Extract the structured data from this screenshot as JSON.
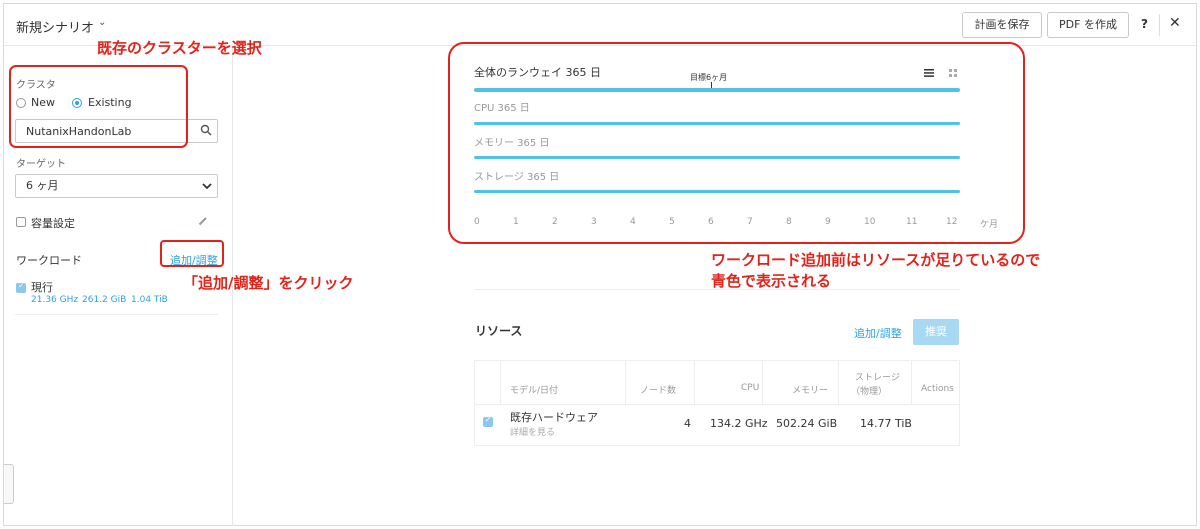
{
  "header": {
    "title": "新規シナリオ",
    "save_label": "計画を保存",
    "pdf_label": "PDF を作成",
    "help_label": "?",
    "close_label": "✕"
  },
  "sidebar": {
    "cluster_label": "クラスタ",
    "radio_new": "New",
    "radio_existing": "Existing",
    "cluster_selected": "Existing",
    "cluster_value": "NutanixHandonLab",
    "target_label": "ターゲット",
    "target_value": "6 ヶ月",
    "capacity_label": "容量設定",
    "workload_label": "ワークロード",
    "workload_add": "追加/調整",
    "current_label": "現行",
    "current_checked": true,
    "stat_cpu": "21.36 GHz",
    "stat_mem": "261.2 GiB",
    "stat_storage": "1.04 TiB"
  },
  "runway": {
    "title": "全体のランウェイ 365 日",
    "target_label": "目標6ヶ月",
    "target_month": 6,
    "cpu_label": "CPU 365 日",
    "memory_label": "メモリー 365 日",
    "storage_label": "ストレージ 365 日",
    "bar_color": "#4fc3e4",
    "months": [
      "0",
      "1",
      "2",
      "3",
      "4",
      "5",
      "6",
      "7",
      "8",
      "9",
      "10",
      "11",
      "12"
    ],
    "unit": "ケ月"
  },
  "resources": {
    "title": "リソース",
    "add_label": "追加/調整",
    "recommend_label": "推奨",
    "headers": {
      "model": "モデル/日付",
      "nodes": "ノード数",
      "cpu": "CPU",
      "memory": "メモリー",
      "storage_1": "ストレージ",
      "storage_2": "（物理）",
      "actions": "Actions"
    },
    "row": {
      "checked": true,
      "model": "既存ハードウェア",
      "details_link": "詳細を見る",
      "nodes": "4",
      "cpu": "134.2 GHz",
      "memory": "502.24 GiB",
      "storage": "14.77 TiB"
    }
  },
  "annotations": {
    "select_cluster": "既存のクラスターを選択",
    "click_add": "「追加/調整」をクリック",
    "note_line1": "ワークロード追加前はリソースが足りているので",
    "note_line2": "青色で表示される",
    "color": "#e2231a"
  }
}
